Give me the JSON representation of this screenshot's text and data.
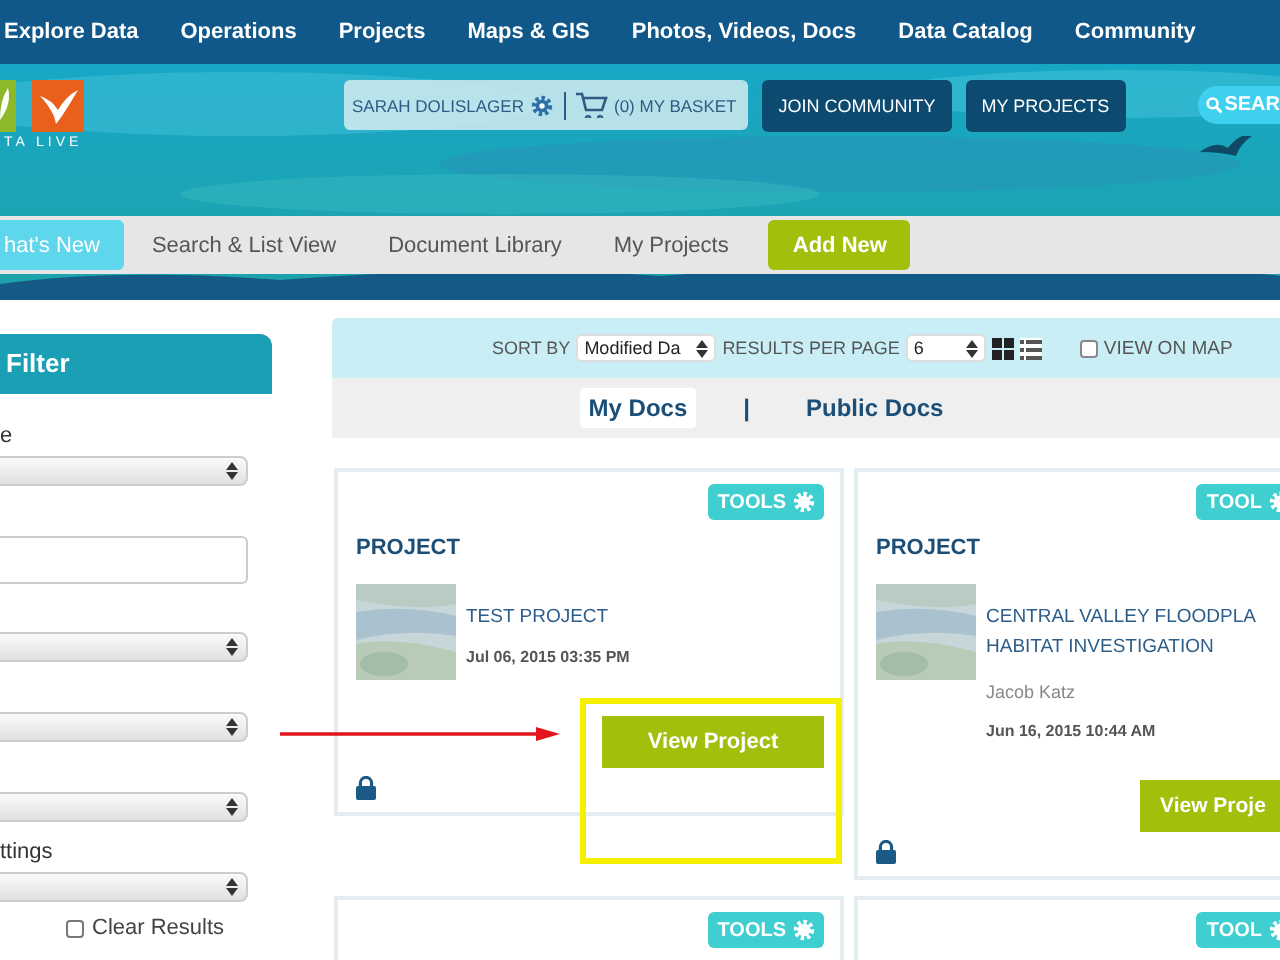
{
  "top_nav": [
    {
      "label": "Explore Data"
    },
    {
      "label": "Operations"
    },
    {
      "label": "Projects"
    },
    {
      "label": "Maps & GIS"
    },
    {
      "label": "Photos, Videos, Docs"
    },
    {
      "label": "Data Catalog"
    },
    {
      "label": "Community"
    }
  ],
  "logo": {
    "text": "TA LIVE"
  },
  "user_menu": {
    "user": "SARAH DOLISLAGER",
    "basket": "(0) MY BASKET"
  },
  "header_buttons": [
    {
      "label": "JOIN COMMUNITY"
    },
    {
      "label": "MY PROJECTS"
    }
  ],
  "search_button": {
    "label": "SEAR"
  },
  "subnav": [
    {
      "label": "hat's New",
      "kind": "tab",
      "selected": true
    },
    {
      "label": "Search & List View",
      "kind": "tab",
      "selected": false
    },
    {
      "label": "Document Library",
      "kind": "tab",
      "selected": false
    },
    {
      "label": "My Projects",
      "kind": "tab",
      "selected": false
    },
    {
      "label": "Add New",
      "kind": "action",
      "selected": false
    }
  ],
  "filter": {
    "title": "Filter",
    "fields": [
      {
        "kind": "select",
        "label": "e"
      },
      {
        "kind": "text"
      },
      {
        "kind": "select"
      },
      {
        "kind": "select"
      },
      {
        "kind": "select"
      },
      {
        "kind": "select",
        "label": "ttings"
      }
    ],
    "clear": {
      "label": "Clear Results",
      "checked": false
    }
  },
  "toolbar": {
    "sort_label": "SORT BY",
    "sort_value": "Modified Da",
    "per_page_label": "RESULTS PER PAGE",
    "per_page_value": "6",
    "view_modes": [
      {
        "kind": "grid",
        "selected": true
      },
      {
        "kind": "list",
        "selected": false
      }
    ],
    "view_on_map": {
      "label": "VIEW ON MAP",
      "checked": false
    }
  },
  "doc_tabs": [
    {
      "label": "My Docs",
      "selected": true
    },
    {
      "label": "Public Docs",
      "selected": false
    }
  ],
  "doc_tab_separator": "|",
  "cards": [
    {
      "tools": "TOOLS",
      "type": "PROJECT",
      "title_lines": [
        "TEST PROJECT"
      ],
      "date": "Jul 06, 2015 03:35 PM",
      "button": "View Project",
      "locked": true,
      "highlighted": true
    },
    {
      "tools": "TOOL",
      "type": "PROJECT",
      "title_lines": [
        "CENTRAL VALLEY FLOODPLA",
        "HABITAT INVESTIGATION"
      ],
      "author": "Jacob Katz",
      "date": "Jun 16, 2015 10:44 AM",
      "button": "View Proje",
      "locked": true,
      "highlighted": false
    },
    {
      "tools": "TOOLS"
    },
    {
      "tools": "TOOL"
    }
  ]
}
